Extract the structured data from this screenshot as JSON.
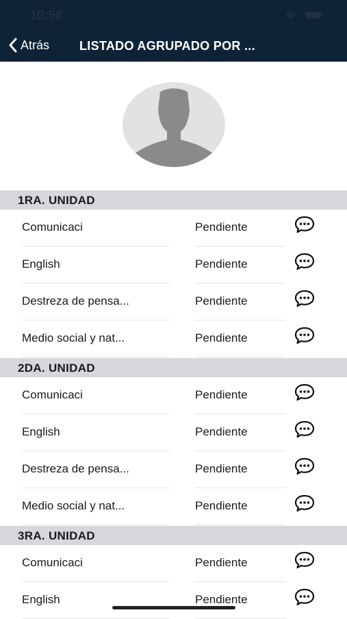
{
  "status_bar": {
    "time": "10:58"
  },
  "nav": {
    "back_label": "Atrás",
    "title": "LISTADO AGRUPADO POR ..."
  },
  "sections": [
    {
      "title": "1RA. UNIDAD",
      "rows": [
        {
          "subject": "Comunicaci",
          "status": "Pendiente"
        },
        {
          "subject": "English",
          "status": "Pendiente"
        },
        {
          "subject": "Destreza de pensa...",
          "status": "Pendiente"
        },
        {
          "subject": "Medio social y nat...",
          "status": "Pendiente"
        }
      ]
    },
    {
      "title": "2DA. UNIDAD",
      "rows": [
        {
          "subject": "Comunicaci",
          "status": "Pendiente"
        },
        {
          "subject": "English",
          "status": "Pendiente"
        },
        {
          "subject": "Destreza de pensa...",
          "status": "Pendiente"
        },
        {
          "subject": "Medio social y nat...",
          "status": "Pendiente"
        }
      ]
    },
    {
      "title": "3RA. UNIDAD",
      "rows": [
        {
          "subject": "Comunicaci",
          "status": "Pendiente"
        },
        {
          "subject": "English",
          "status": "Pendiente"
        }
      ]
    }
  ],
  "colors": {
    "header_bg": "#0f2336",
    "section_bg": "#d5d7da",
    "avatar_bg": "#e2e2e2",
    "avatar_figure": "#8a8a8a"
  },
  "icons": {
    "back": "chevron-left-icon",
    "comment": "speech-bubble-icon",
    "wifi": "wifi-icon",
    "battery": "battery-icon"
  }
}
